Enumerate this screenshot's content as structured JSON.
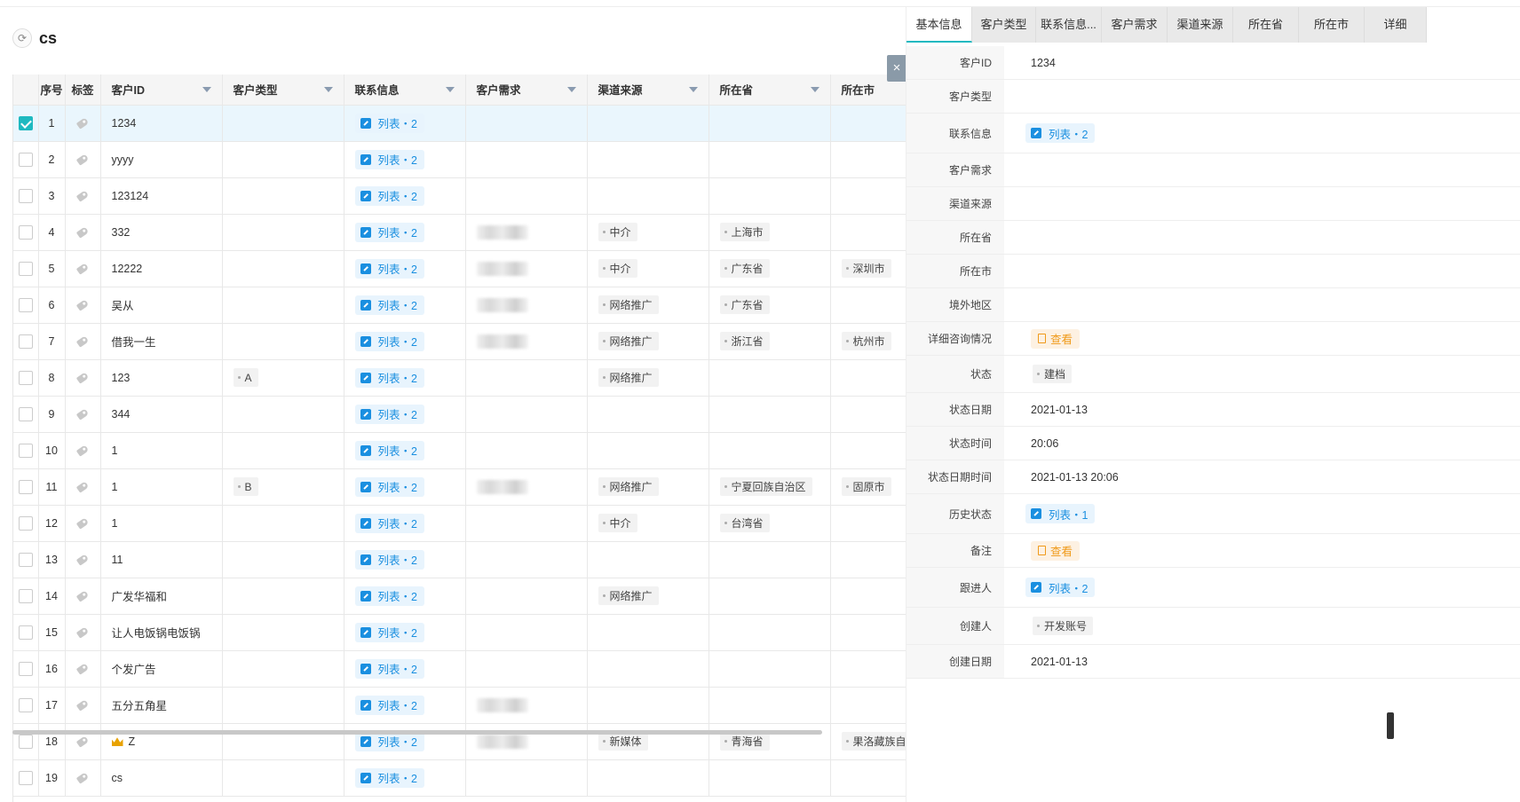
{
  "page": {
    "title": "cs",
    "refresh_icon": "refresh-icon"
  },
  "table": {
    "columns": {
      "seq": "序号",
      "tag": "标签",
      "customer_id": "客户ID",
      "customer_type": "客户类型",
      "contact": "联系信息",
      "demand": "客户需求",
      "channel": "渠道来源",
      "province": "所在省",
      "city": "所在市"
    },
    "list_label_2": "列表・2",
    "rows": [
      {
        "seq": "1",
        "id": "1234",
        "type": "",
        "demand": false,
        "channel": "",
        "province": "",
        "city": "",
        "selected": true
      },
      {
        "seq": "2",
        "id": "yyyy",
        "type": "",
        "demand": false,
        "channel": "",
        "province": "",
        "city": ""
      },
      {
        "seq": "3",
        "id": "123124",
        "type": "",
        "demand": false,
        "channel": "",
        "province": "",
        "city": ""
      },
      {
        "seq": "4",
        "id": "332",
        "type": "",
        "demand": true,
        "channel": "中介",
        "province": "上海市",
        "city": ""
      },
      {
        "seq": "5",
        "id": "12222",
        "type": "",
        "demand": true,
        "channel": "中介",
        "province": "广东省",
        "city": "深圳市"
      },
      {
        "seq": "6",
        "id": "吴从",
        "type": "",
        "demand": true,
        "channel": "网络推广",
        "province": "广东省",
        "city": ""
      },
      {
        "seq": "7",
        "id": "借我一生",
        "type": "",
        "demand": true,
        "channel": "网络推广",
        "province": "浙江省",
        "city": "杭州市"
      },
      {
        "seq": "8",
        "id": "123",
        "type": "A",
        "demand": false,
        "channel": "网络推广",
        "province": "",
        "city": ""
      },
      {
        "seq": "9",
        "id": "344",
        "type": "",
        "demand": false,
        "channel": "",
        "province": "",
        "city": ""
      },
      {
        "seq": "10",
        "id": "1",
        "type": "",
        "demand": false,
        "channel": "",
        "province": "",
        "city": ""
      },
      {
        "seq": "11",
        "id": "1",
        "type": "B",
        "demand": true,
        "channel": "网络推广",
        "province": "宁夏回族自治区",
        "city": "固原市"
      },
      {
        "seq": "12",
        "id": "1",
        "type": "",
        "demand": false,
        "channel": "中介",
        "province": "台湾省",
        "city": ""
      },
      {
        "seq": "13",
        "id": "11",
        "type": "",
        "demand": false,
        "channel": "",
        "province": "",
        "city": ""
      },
      {
        "seq": "14",
        "id": "广发华福和",
        "type": "",
        "demand": false,
        "channel": "网络推广",
        "province": "",
        "city": ""
      },
      {
        "seq": "15",
        "id": "让人电饭锅电饭锅",
        "type": "",
        "demand": false,
        "channel": "",
        "province": "",
        "city": ""
      },
      {
        "seq": "16",
        "id": "个发广告",
        "type": "",
        "demand": false,
        "channel": "",
        "province": "",
        "city": ""
      },
      {
        "seq": "17",
        "id": "五分五角星",
        "type": "",
        "demand": true,
        "channel": "",
        "province": "",
        "city": ""
      },
      {
        "seq": "18",
        "id": "Z",
        "crown": true,
        "type": "",
        "demand": true,
        "channel": "新媒体",
        "province": "青海省",
        "city": "果洛藏族自"
      },
      {
        "seq": "19",
        "id": "cs",
        "type": "",
        "demand": false,
        "channel": "",
        "province": "",
        "city": ""
      }
    ]
  },
  "close_label": "×",
  "detail": {
    "tabs": [
      "基本信息",
      "客户类型",
      "联系信息...",
      "客户需求",
      "渠道来源",
      "所在省",
      "所在市",
      "详细"
    ],
    "fields": [
      {
        "label": "客户ID",
        "kind": "text",
        "value": "1234"
      },
      {
        "label": "客户类型",
        "kind": "empty",
        "value": ""
      },
      {
        "label": "联系信息",
        "kind": "list",
        "value": "列表・2"
      },
      {
        "label": "客户需求",
        "kind": "empty",
        "value": ""
      },
      {
        "label": "渠道来源",
        "kind": "empty",
        "value": ""
      },
      {
        "label": "所在省",
        "kind": "empty",
        "value": ""
      },
      {
        "label": "所在市",
        "kind": "empty",
        "value": ""
      },
      {
        "label": "境外地区",
        "kind": "empty",
        "value": ""
      },
      {
        "label": "详细咨询情况",
        "kind": "view",
        "value": "查看"
      },
      {
        "label": "状态",
        "kind": "chip",
        "value": "建档"
      },
      {
        "label": "状态日期",
        "kind": "text",
        "value": "2021-01-13"
      },
      {
        "label": "状态时间",
        "kind": "text",
        "value": "20:06"
      },
      {
        "label": "状态日期时间",
        "kind": "text",
        "value": "2021-01-13 20:06"
      },
      {
        "label": "历史状态",
        "kind": "list",
        "value": "列表・1"
      },
      {
        "label": "备注",
        "kind": "view",
        "value": "查看"
      },
      {
        "label": "跟进人",
        "kind": "list",
        "value": "列表・2"
      },
      {
        "label": "创建人",
        "kind": "chip",
        "value": "开发账号"
      },
      {
        "label": "创建日期",
        "kind": "text",
        "value": "2021-01-13"
      }
    ]
  },
  "colors": {
    "accent": "#1eb9c0",
    "link": "#1a8fe0",
    "warning": "#f09a1a"
  }
}
